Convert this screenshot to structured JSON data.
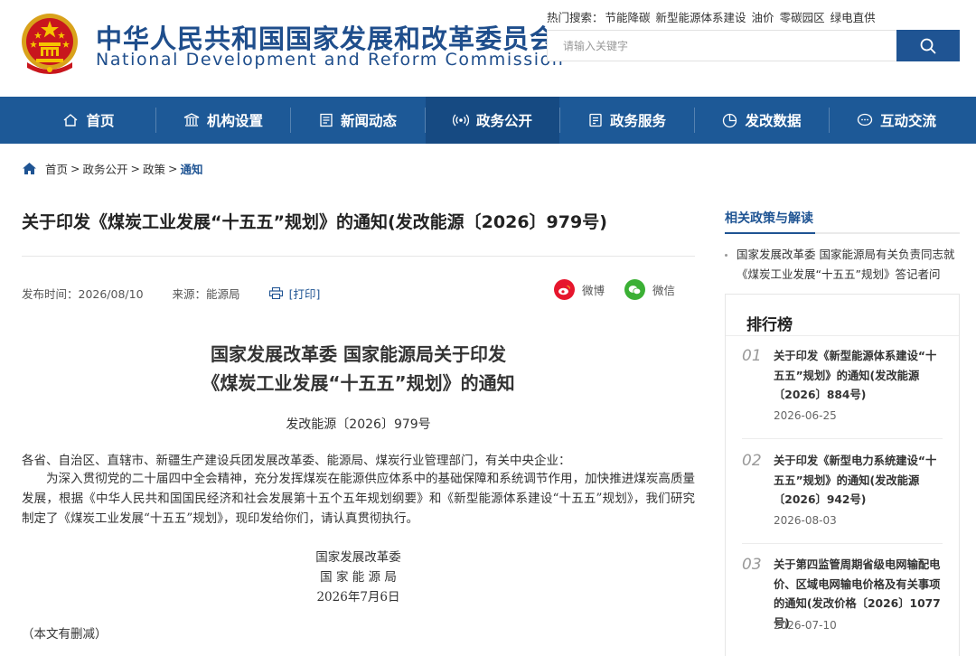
{
  "header": {
    "title_cn": "中华人民共和国国家发展和改革委员会",
    "title_en": "National Development and Reform Commission",
    "hot_label": "热门搜索：",
    "hot_terms": [
      "节能降碳",
      "新型能源体系建设",
      "油价",
      "零碳园区",
      "绿电直供"
    ],
    "search_placeholder": "请输入关键字",
    "brand_color": "#1d5997"
  },
  "nav": {
    "items": [
      {
        "label": "首页",
        "icon": "home-icon"
      },
      {
        "label": "机构设置",
        "icon": "institution-icon"
      },
      {
        "label": "新闻动态",
        "icon": "news-icon"
      },
      {
        "label": "政务公开",
        "icon": "broadcast-icon",
        "active": true
      },
      {
        "label": "政务服务",
        "icon": "service-icon"
      },
      {
        "label": "发改数据",
        "icon": "pie-chart-icon"
      },
      {
        "label": "互动交流",
        "icon": "chat-icon"
      }
    ]
  },
  "breadcrumb": [
    "首页",
    "政务公开",
    "政策",
    "通知"
  ],
  "article": {
    "title": "关于印发《煤炭工业发展“十五五”规划》的通知(发改能源〔2026〕979号)",
    "publish_time": "发布时间：2026/08/10",
    "source": "来源：能源局",
    "print": "[打印]",
    "share_weibo": "微博",
    "share_wechat": "微信",
    "doc_heading_1": "国家发展改革委 国家能源局关于印发",
    "doc_heading_2": "《煤炭工业发展“十五五”规划》的通知",
    "doc_no": "发改能源〔2026〕979号",
    "salutation": "各省、自治区、直辖市、新疆生产建设兵团发展改革委、能源局、煤炭行业管理部门，有关中央企业：",
    "paragraph": "为深入贯彻党的二十届四中全会精神，充分发挥煤炭在能源供应体系中的基础保障和系统调节作用，加快推进煤炭高质量发展，根据《中华人民共和国国民经济和社会发展第十五个五年规划纲要》和《新型能源体系建设“十五五”规划》，我们研究制定了《煤炭工业发展“十五五”规划》，现印发给你们，请认真贯彻执行。",
    "sign_1": "国家发展改革委",
    "sign_2": "国 家 能 源 局",
    "sign_date": "2026年7月6日",
    "note": "（本文有删减）"
  },
  "sidebar": {
    "related_title": "相关政策与解读",
    "related_items": [
      "国家发展改革委 国家能源局有关负责同志就《煤炭工业发展“十五五”规划》答记者问"
    ],
    "rank_title": "排行榜",
    "rank_items": [
      {
        "num": "01",
        "text": "关于印发《新型能源体系建设“十五五”规划》的通知(发改能源〔2026〕884号)",
        "date": "2026-06-25"
      },
      {
        "num": "02",
        "text": "关于印发《新型电力系统建设“十五五”规划》的通知(发改能源〔2026〕942号)",
        "date": "2026-08-03"
      },
      {
        "num": "03",
        "text": "关于第四监管周期省级电网输配电价、区域电网输电价格及有关事项的通知(发改价格〔2026〕1077号)",
        "date": "2026-07-10"
      }
    ]
  }
}
